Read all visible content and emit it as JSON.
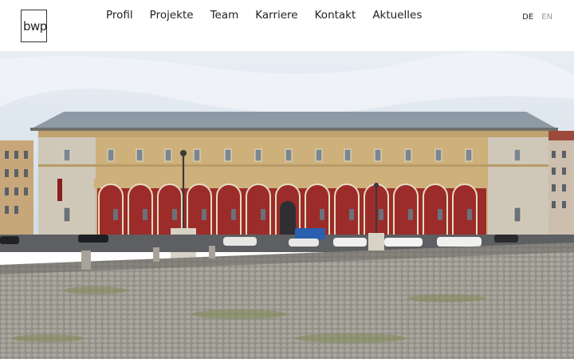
{
  "logo": {
    "text": "bwp"
  },
  "nav": {
    "items": [
      "Profil",
      "Projekte",
      "Team",
      "Karriere",
      "Kontakt",
      "Aktuelles"
    ]
  },
  "language": {
    "active": "DE",
    "inactive": "EN",
    "active_color": "#222222",
    "inactive_color": "#9a9a9a"
  },
  "hero": {
    "colors": {
      "sky": "#d9e3ec",
      "facade": "#cdb07a",
      "arcade": "#9c2c2a",
      "roof": "#8e9aa6",
      "cobblestone": "#8f8d86"
    }
  }
}
